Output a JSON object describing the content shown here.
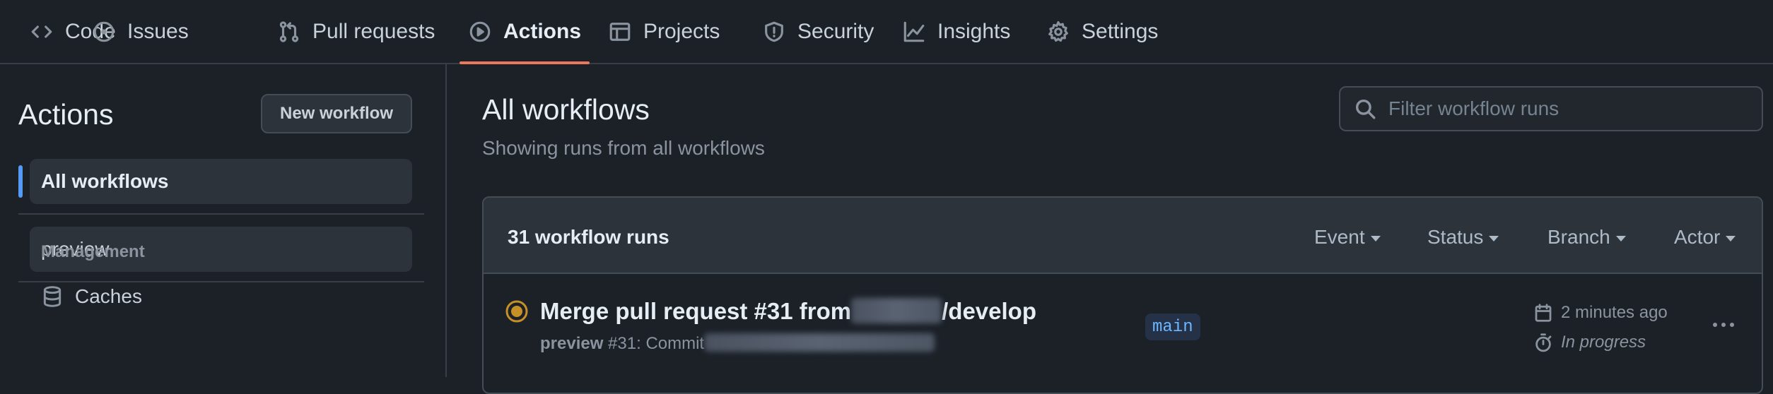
{
  "nav": {
    "tabs": [
      {
        "label": "Code",
        "icon": "code-icon"
      },
      {
        "label": "Issues",
        "icon": "issue-opened-icon"
      },
      {
        "label": "Pull requests",
        "icon": "git-pull-request-icon"
      },
      {
        "label": "Actions",
        "icon": "play-icon",
        "active": true
      },
      {
        "label": "Projects",
        "icon": "table-icon"
      },
      {
        "label": "Security",
        "icon": "shield-icon"
      },
      {
        "label": "Insights",
        "icon": "graph-icon"
      },
      {
        "label": "Settings",
        "icon": "gear-icon"
      }
    ],
    "active_underline_color": "#ec775c"
  },
  "sidebar": {
    "title": "Actions",
    "new_workflow_label": "New workflow",
    "items": [
      {
        "label": "All workflows",
        "selected": true
      },
      {
        "label": "preview"
      }
    ],
    "management_heading": "Management",
    "caches_label": "Caches",
    "accent_color": "#539bf5"
  },
  "main": {
    "title": "All workflows",
    "subtitle": "Showing runs from all workflows",
    "search": {
      "placeholder": "Filter workflow runs",
      "value": ""
    },
    "runs": {
      "count_label": "31 workflow runs",
      "filters": [
        "Event",
        "Status",
        "Branch",
        "Actor"
      ],
      "items": [
        {
          "title_prefix": "Merge pull request #31 from",
          "title_suffix": "/develop",
          "workflow": "preview",
          "meta_text": " #31: Commit",
          "branch": "main",
          "time": "2 minutes ago",
          "duration": "In progress",
          "status": "in-progress",
          "status_color": "#c69026"
        }
      ]
    }
  }
}
